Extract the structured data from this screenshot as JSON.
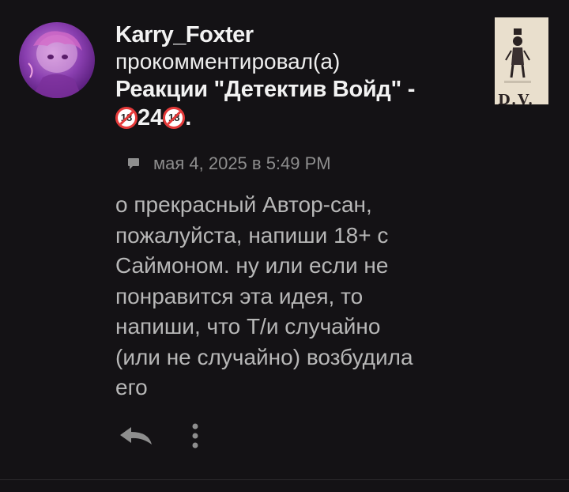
{
  "notification": {
    "author": "Karry_Foxter",
    "action": "прокомментировал(а)",
    "target_title": "Реакции \"Детектив Войд\" -",
    "target_number": "24",
    "target_end": ".",
    "age_badge": "18",
    "timestamp": "мая 4, 2025 в 5:49 PM",
    "comment": "о прекрасный Автор-сан,\nпожалуйста, напиши 18+ с\nСаймоном. ну или если не\nпонравится эта идея, то\nнапиши, что Т/и случайно\n(или не случайно) возбудила\nего",
    "thumbnail_caption": "D.V."
  },
  "icons": {
    "comment": "comment-icon",
    "reply": "reply-icon",
    "more": "more-vertical-icon",
    "age_restricted": "no-under-18-icon"
  },
  "colors": {
    "background": "#141215",
    "primary_text": "#f2f2f2",
    "comment_text": "#b7b7b7",
    "meta_text": "#8e8e8e",
    "age_badge_red": "#e53a3a"
  }
}
